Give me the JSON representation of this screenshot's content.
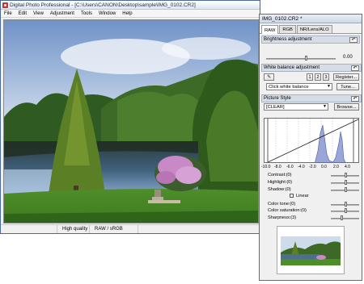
{
  "main_window": {
    "title": "Digital Photo Professional - [C:\\Users\\CANON\\Desktop\\sample\\IMG_0102.CR2]",
    "menu": [
      "File",
      "Edit",
      "View",
      "Adjustment",
      "Tools",
      "Window",
      "Help"
    ],
    "status": {
      "quality": "High quality",
      "color_space": "RAW / sRGB"
    }
  },
  "palette": {
    "title": "IMG_0102.CR2 *",
    "tabs": [
      "RAW",
      "RGB",
      "NR/Lens/ALO"
    ],
    "active_tab": "RAW",
    "brightness": {
      "heading": "Brightness adjustment",
      "value": "0.00",
      "undo_icon": "undo-arrow-icon"
    },
    "white_balance": {
      "heading": "White balance adjustment",
      "preset_slots": [
        "1",
        "2",
        "3"
      ],
      "register_label": "Register...",
      "selected": "Click white balance",
      "tune_label": "Tune...",
      "eyedropper_icon": "eyedropper-icon"
    },
    "picture_style": {
      "heading": "Picture Style",
      "selected": "[CLEAR]",
      "browse_label": "Browse...",
      "axis_ticks": [
        "-10.0",
        "-8.0",
        "-6.0",
        "-4.0",
        "-2.0",
        "0.0",
        "2.0",
        "4.0"
      ]
    },
    "params": {
      "contrast": "Contrast:(0)",
      "highlight": "Highlight:(0)",
      "shadow": "Shadow:(0)",
      "linear": "Linear",
      "linear_checked": false,
      "color_tone": "Color tone:(0)",
      "color_saturation": "Color saturation:(0)",
      "sharpness": "Sharpness:(3)"
    }
  },
  "colors": {
    "title_bar": "#dce6f2",
    "histogram_fill": "#9aa6d8",
    "section_header": "#d7dde6"
  }
}
